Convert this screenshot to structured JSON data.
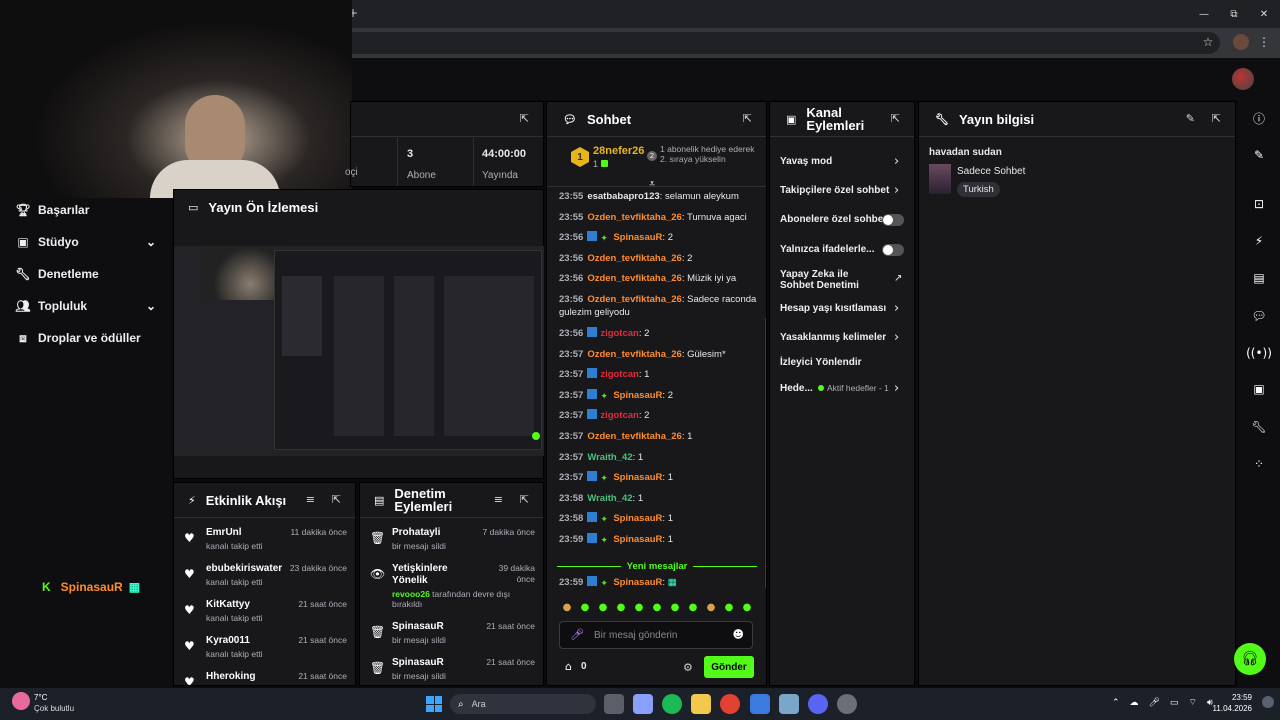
{
  "browser": {
    "new_tab": "+",
    "minimize": "—",
    "maximize": "⧉",
    "close": "✕",
    "star": "☆",
    "menu": "⋮"
  },
  "sidebar": {
    "items": [
      {
        "label": "Başarılar",
        "icon": "trophy-icon",
        "chevron": false
      },
      {
        "label": "Stüdyo",
        "icon": "studio-icon",
        "chevron": true
      },
      {
        "label": "Denetleme",
        "icon": "wrench-icon",
        "chevron": false
      },
      {
        "label": "Topluluk",
        "icon": "people-icon",
        "chevron": true
      },
      {
        "label": "Droplar ve ödüller",
        "icon": "gift-icon",
        "chevron": false
      }
    ],
    "mini_user": "SpinasauR"
  },
  "stats": [
    {
      "value": "3",
      "label": "Abone"
    },
    {
      "value": "44:00:00",
      "label": "Yayında"
    }
  ],
  "stats_partial": "oçi",
  "preview": {
    "title": "Yayın Ön İzlemesi"
  },
  "activity": {
    "title": "Etkinlik Akışı",
    "items": [
      {
        "name": "EmrUnl",
        "sub": "kanalı takip etti",
        "time": "11 dakika önce"
      },
      {
        "name": "ebubekiriswater",
        "sub": "kanalı takip etti",
        "time": "23 dakika önce"
      },
      {
        "name": "KitKattyy",
        "sub": "kanalı takip etti",
        "time": "21 saat önce"
      },
      {
        "name": "Kyra0011",
        "sub": "kanalı takip etti",
        "time": "21 saat önce"
      },
      {
        "name": "Hheroking",
        "sub": "",
        "time": "21 saat önce"
      }
    ]
  },
  "modlog": {
    "title": "Denetim Eylemleri",
    "items": [
      {
        "name": "Prohatayli",
        "sub": "bir mesajı sildi",
        "time": "7 dakika önce",
        "icon": "trash-icon"
      },
      {
        "name": "Yetişkinlere Yönelik",
        "sub_user": "revooo26",
        "sub": "tarafından devre dışı bırakıldı",
        "time": "39 dakika önce",
        "icon": "eye-icon"
      },
      {
        "name": "SpinasauR",
        "sub": "bir mesajı sildi",
        "time": "21 saat önce",
        "icon": "trash-icon"
      },
      {
        "name": "SpinasauR",
        "sub": "bir mesajı sildi",
        "time": "21 saat önce",
        "icon": "trash-icon"
      }
    ]
  },
  "chat": {
    "title": "Sohbet",
    "pinned_user": "28nefer26",
    "pinned_rank": "1",
    "pinned_count": "1",
    "pinned_text": "1 abonelik hediye ederek 2. sıraya yükselin",
    "messages": [
      {
        "time": "23:55",
        "user": "esatbabapro123",
        "color": "#e8e8ea",
        "badges": 0,
        "text": "selamun aleykum"
      },
      {
        "time": "23:55",
        "user": "Ozden_tevfiktaha_26",
        "color": "#ff8c2e",
        "badges": 0,
        "text": "Turnuva agaci"
      },
      {
        "time": "23:56",
        "user": "SpinasauR",
        "color": "#ff8c2e",
        "badges": 2,
        "text": "2"
      },
      {
        "time": "23:56",
        "user": "Ozden_tevfiktaha_26",
        "color": "#ff8c2e",
        "badges": 0,
        "text": "2"
      },
      {
        "time": "23:56",
        "user": "Ozden_tevfiktaha_26",
        "color": "#ff8c2e",
        "badges": 0,
        "text": "Müzik iyi ya"
      },
      {
        "time": "23:56",
        "user": "Ozden_tevfiktaha_26",
        "color": "#ff8c2e",
        "badges": 0,
        "text": "Sadece raconda gulezim geliyodu"
      },
      {
        "time": "23:56",
        "user": "zigotcan",
        "color": "#e02c3c",
        "badges": 1,
        "text": "2"
      },
      {
        "time": "23:57",
        "user": "Ozden_tevfiktaha_26",
        "color": "#ff8c2e",
        "badges": 0,
        "text": "Gülesim*"
      },
      {
        "time": "23:57",
        "user": "zigotcan",
        "color": "#e02c3c",
        "badges": 1,
        "text": "1"
      },
      {
        "time": "23:57",
        "user": "SpinasauR",
        "color": "#ff8c2e",
        "badges": 2,
        "text": "2"
      },
      {
        "time": "23:57",
        "user": "zigotcan",
        "color": "#e02c3c",
        "badges": 1,
        "text": "2"
      },
      {
        "time": "23:57",
        "user": "Ozden_tevfiktaha_26",
        "color": "#ff8c2e",
        "badges": 0,
        "text": "1"
      },
      {
        "time": "23:57",
        "user": "Wraith_42",
        "color": "#4fbf7f",
        "badges": 0,
        "text": "1"
      },
      {
        "time": "23:57",
        "user": "SpinasauR",
        "color": "#ff8c2e",
        "badges": 2,
        "text": "1"
      },
      {
        "time": "23:58",
        "user": "Wraith_42",
        "color": "#4fbf7f",
        "badges": 0,
        "text": "1"
      },
      {
        "time": "23:58",
        "user": "SpinasauR",
        "color": "#ff8c2e",
        "badges": 2,
        "text": "1"
      },
      {
        "time": "23:59",
        "user": "SpinasauR",
        "color": "#ff8c2e",
        "badges": 2,
        "text": "1"
      }
    ],
    "new_messages": "Yeni mesajlar",
    "last_message": {
      "time": "23:59",
      "user": "SpinasauR"
    },
    "input_placeholder": "Bir mesaj gönderin",
    "points": "0",
    "send_label": "Gönder"
  },
  "actions": {
    "title": "Kanal Eylemleri",
    "items": [
      {
        "label": "Yavaş mod",
        "control": "chevron"
      },
      {
        "label": "Takipçilere özel sohbet",
        "control": "chevron"
      },
      {
        "label": "Abonelere özel sohbet",
        "control": "toggle"
      },
      {
        "label": "Yalnızca ifadelerle...",
        "control": "toggle"
      },
      {
        "label": "Yapay Zeka ile Sohbet Denetimi",
        "control": "external"
      },
      {
        "label": "Hesap yaşı kısıtlaması",
        "control": "chevron"
      },
      {
        "label": "Yasaklanmış kelimeler",
        "control": "chevron"
      },
      {
        "label": "İzleyici Yönlendir",
        "control": "none"
      },
      {
        "label": "Hede...",
        "control": "chevron"
      }
    ],
    "goals_status": "Aktif hedefler - 1"
  },
  "info": {
    "title": "Yayın bilgisi",
    "stream_title": "havadan sudan",
    "category": "Sadece Sohbet",
    "language": "Turkish"
  },
  "taskbar": {
    "weather_temp": "7°C",
    "weather_desc": "Çok bulutlu",
    "search": "Ara",
    "time": "23:59",
    "date": "11.04.2026"
  }
}
